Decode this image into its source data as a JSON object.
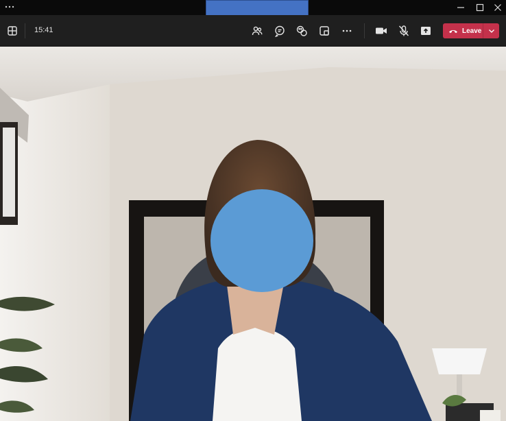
{
  "window": {
    "menu_icon": "more-horizontal-icon",
    "controls": [
      "minimize-icon",
      "maximize-icon",
      "close-icon"
    ]
  },
  "toolbar": {
    "clock": "15:41",
    "leave_label": "Leave",
    "icons": [
      "grid-layout-icon",
      "people-icon",
      "chat-icon",
      "react-icon",
      "rooms-icon",
      "more-icon",
      "camera-icon",
      "mic-off-icon",
      "share-icon",
      "phone-hangup-icon",
      "chevron-down-icon"
    ]
  },
  "colors": {
    "leave": "#c4314b",
    "title_redaction": "#4472c4",
    "face_redaction": "#5b9bd5"
  }
}
